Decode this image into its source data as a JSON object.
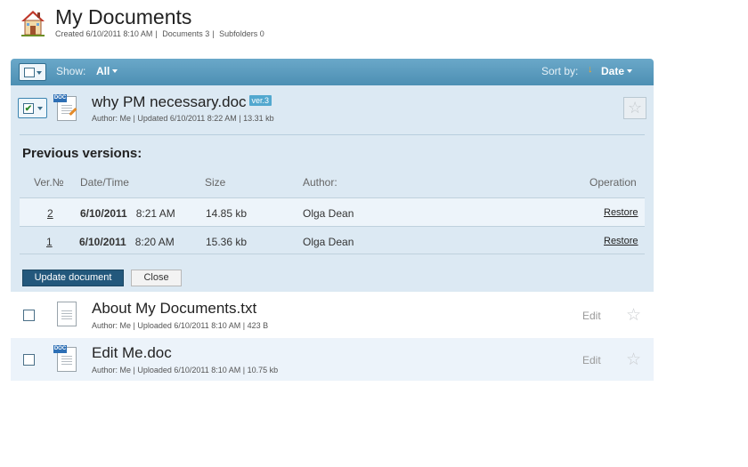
{
  "header": {
    "title": "My Documents",
    "created": "Created 6/10/2011 8:10 AM",
    "documents": "Documents 3",
    "subfolders": "Subfolders 0",
    "separator": "|"
  },
  "toolbar": {
    "show_label": "Show:",
    "show_value": "All",
    "sort_label": "Sort by:",
    "sort_value": "Date",
    "sort_arrow": "↓"
  },
  "selected_file": {
    "name": "why PM necessary.doc",
    "version_badge": "ver.3",
    "meta": "Author: Me | Updated 6/10/2011 8:22 AM | 13.31 kb",
    "icon": "doc-edit-icon",
    "badge": "DOC"
  },
  "versions": {
    "title": "Previous versions:",
    "columns": [
      "Ver.№",
      "Date/Time",
      "Size",
      "Author:",
      "Operation"
    ],
    "rows": [
      {
        "num": "2",
        "date": "6/10/2011",
        "time": "8:21 AM",
        "size": "14.85 kb",
        "author": "Olga Dean",
        "operation": "Restore"
      },
      {
        "num": "1",
        "date": "6/10/2011",
        "time": "8:20 AM",
        "size": "15.36 kb",
        "author": "Olga Dean",
        "operation": "Restore"
      }
    ],
    "update_button": "Update document",
    "close_button": "Close"
  },
  "files": [
    {
      "name": "About My Documents.txt",
      "meta": "Author: Me | Uploaded 6/10/2011 8:10 AM | 423 B",
      "edit": "Edit",
      "icon": "txt-file-icon"
    },
    {
      "name": "Edit Me.doc",
      "meta": "Author: Me | Uploaded 6/10/2011 8:10 AM | 10.75 kb",
      "edit": "Edit",
      "icon": "doc-file-icon",
      "badge": "DOC"
    }
  ],
  "icons": {
    "star": "☆",
    "check": "✔"
  },
  "colors": {
    "toolbar": "#5b9bbf",
    "expanded_bg": "#dce9f3",
    "update_button": "#23587c",
    "version_badge": "#52a8cf"
  }
}
